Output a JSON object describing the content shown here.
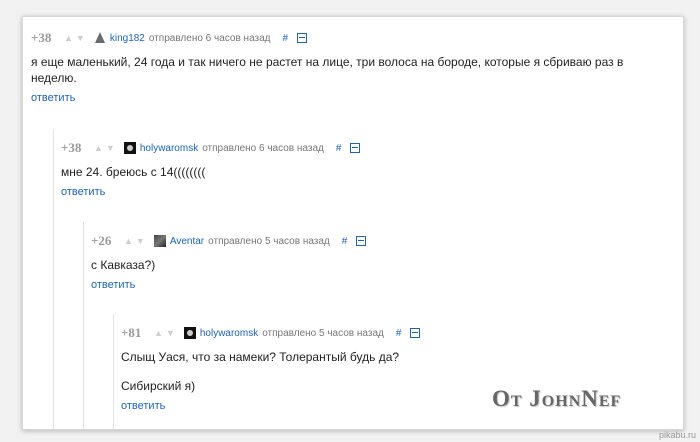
{
  "comments": [
    {
      "rating": "+38",
      "author": "king182",
      "time": "отправлено 6 часов назад",
      "hash": "#",
      "body": [
        "я еще маленький, 24 года и так ничего не растет на лице, три волоса на бороде, которые я сбриваю раз в неделю."
      ],
      "reply": "ответить"
    },
    {
      "rating": "+38",
      "author": "holywaromsk",
      "time": "отправлено 6 часов назад",
      "hash": "#",
      "body": [
        "мне 24. бреюсь с 14(((((((("
      ],
      "reply": "ответить"
    },
    {
      "rating": "+26",
      "author": "Aventar",
      "time": "отправлено 5 часов назад",
      "hash": "#",
      "body": [
        "с Кавказа?)"
      ],
      "reply": "ответить"
    },
    {
      "rating": "+81",
      "author": "holywaromsk",
      "time": "отправлено 5 часов назад",
      "hash": "#",
      "body": [
        "Слыщ Уася, что за намеки? Толерантый будь да?",
        "Сибирский я)"
      ],
      "reply": "ответить"
    }
  ],
  "icons": {
    "vote_up": "triangle-up-icon",
    "vote_down": "triangle-down-icon",
    "collapse": "minus-box-icon"
  },
  "watermark": "От JohnNef",
  "site": "pikabu.ru"
}
